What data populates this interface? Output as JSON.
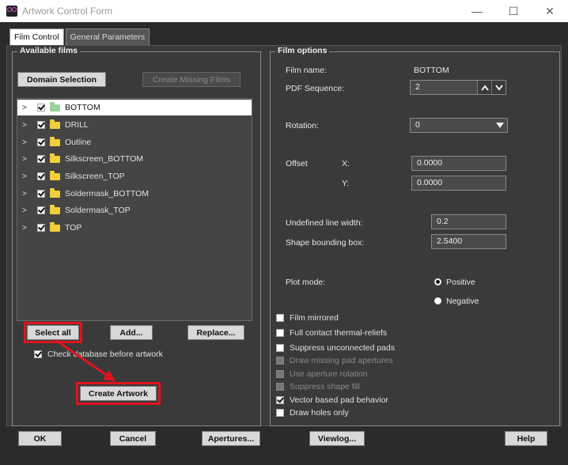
{
  "window": {
    "title": "Artwork Control Form",
    "minimize": "—",
    "maximize": "☐",
    "close": "✕"
  },
  "tabs": [
    {
      "label": "Film Control"
    },
    {
      "label": "General Parameters"
    }
  ],
  "available_films": {
    "legend": "Available films",
    "domain_selection": "Domain Selection",
    "create_missing": "Create Missing Films",
    "films": [
      {
        "name": "BOTTOM",
        "checked": true,
        "selected": true
      },
      {
        "name": "DRILL",
        "checked": true
      },
      {
        "name": "Outline",
        "checked": true
      },
      {
        "name": "Silkscreen_BOTTOM",
        "checked": true
      },
      {
        "name": "Silkscreen_TOP",
        "checked": true
      },
      {
        "name": "Soldermask_BOTTOM",
        "checked": true
      },
      {
        "name": "Soldermask_TOP",
        "checked": true
      },
      {
        "name": "TOP",
        "checked": true
      }
    ],
    "select_all": "Select all",
    "add": "Add...",
    "replace": "Replace...",
    "check_database": "Check database before artwork",
    "create_artwork": "Create Artwork"
  },
  "film_options": {
    "legend": "Film options",
    "film_name_label": "Film name:",
    "film_name_value": "BOTTOM",
    "pdf_sequence_label": "PDF Sequence:",
    "pdf_sequence_value": "2",
    "rotation_label": "Rotation:",
    "rotation_value": "0",
    "offset_label": "Offset",
    "x_label": "X:",
    "x_value": "0.0000",
    "y_label": "Y:",
    "y_value": "0.0000",
    "undefined_line_width_label": "Undefined line width:",
    "undefined_line_width_value": "0.2",
    "shape_bbox_label": "Shape bounding box:",
    "shape_bbox_value": "2.5400",
    "plot_mode_label": "Plot mode:",
    "positive": "Positive",
    "negative": "Negative",
    "options": [
      {
        "label": "Film mirrored",
        "checked": false,
        "disabled": false
      },
      {
        "label": "Full contact thermal-reliefs",
        "checked": false,
        "disabled": false
      },
      {
        "label": "Suppress unconnected pads",
        "checked": false,
        "disabled": false
      },
      {
        "label": "Draw missing pad apertures",
        "checked": false,
        "disabled": true
      },
      {
        "label": "Use aperture rotation",
        "checked": false,
        "disabled": true
      },
      {
        "label": "Suppress shape fill",
        "checked": false,
        "disabled": true
      },
      {
        "label": "Vector based pad behavior",
        "checked": true,
        "disabled": false
      },
      {
        "label": "Draw holes only",
        "checked": false,
        "disabled": false
      }
    ]
  },
  "footer": {
    "ok": "OK",
    "cancel": "Cancel",
    "apertures": "Apertures...",
    "viewlog": "Viewlog...",
    "help": "Help"
  },
  "colors": {
    "highlight": "#e0141e",
    "background": "#2b2b2b",
    "panel": "#3a3a3a"
  }
}
